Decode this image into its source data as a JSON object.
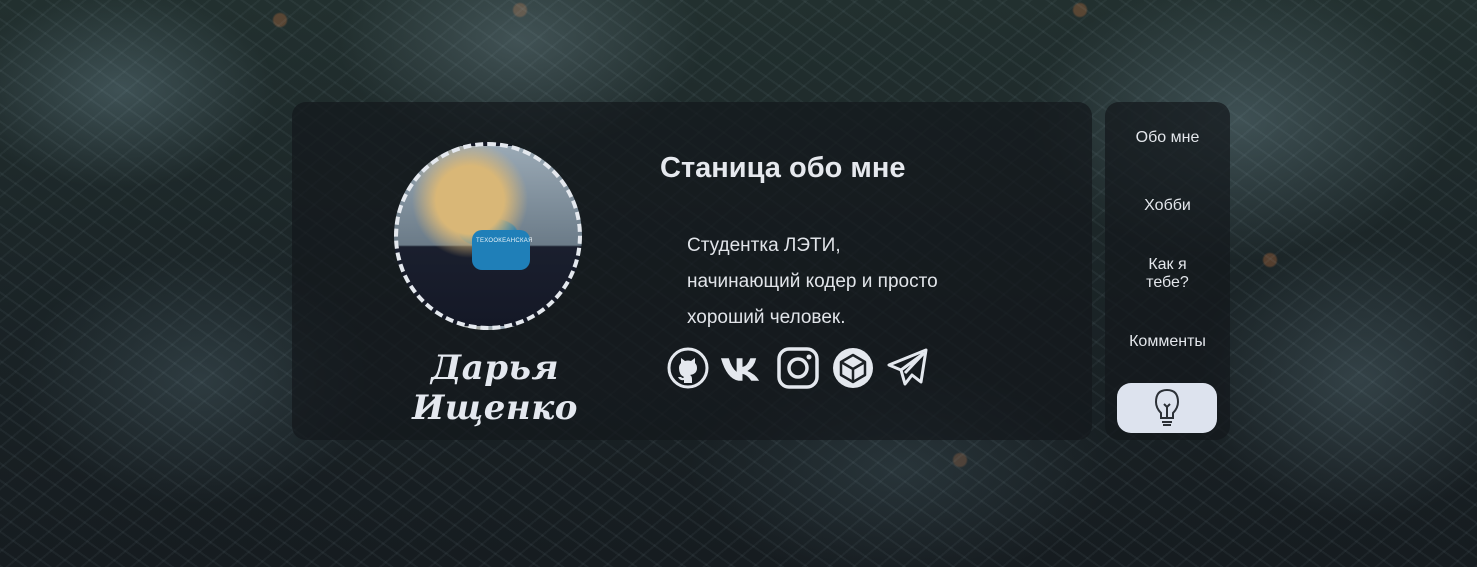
{
  "profile": {
    "name": "Дарья Ищенко",
    "avatar_mask_text": "ТЕХООКЕАНСКАЯ"
  },
  "about": {
    "title": "Станица обо мне",
    "bio": "Студентка ЛЭТИ,\nначинающий кодер и просто\nхороший человек."
  },
  "socials": [
    {
      "icon": "github-icon"
    },
    {
      "icon": "vk-icon"
    },
    {
      "icon": "instagram-icon"
    },
    {
      "icon": "codesandbox-icon"
    },
    {
      "icon": "telegram-icon"
    }
  ],
  "nav": {
    "items": [
      "Обо мне",
      "Хобби",
      "Как я\nтебе?",
      "Комменты"
    ],
    "theme_toggle_icon": "lightbulb-icon"
  },
  "colors": {
    "panel": "#14181c",
    "text": "#e4e8ee",
    "toggle_bg": "#dde3ee"
  }
}
